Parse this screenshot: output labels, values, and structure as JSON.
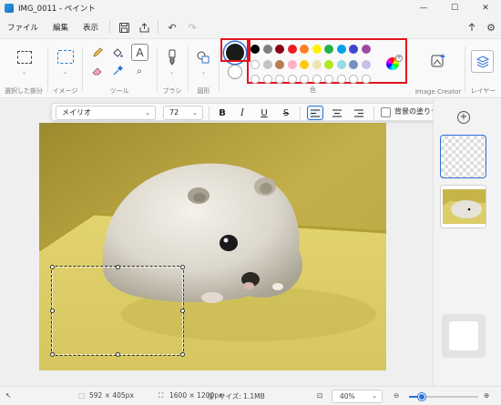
{
  "window": {
    "title": "IMG_0011 - ペイント",
    "controls": [
      "—",
      "☐",
      "✕"
    ]
  },
  "menu": {
    "items": [
      "ファイル",
      "編集",
      "表示"
    ],
    "save_icon": "save-icon",
    "share_icon": "share-icon",
    "undo_icon": "undo-icon",
    "redo_icon": "redo-icon"
  },
  "ribbon": {
    "groups": {
      "selection": "選択した部分",
      "image": "イメージ",
      "tools": "ツール",
      "brushes": "ブラシ",
      "shapes": "図形",
      "colors": "色",
      "image_creator": "Image Creator",
      "layers": "レイヤー"
    }
  },
  "colors": {
    "current": "#1a1a1a",
    "secondary": "#ffffff",
    "highlight": "#e3121c",
    "row1": [
      "#000000",
      "#7f7f7f",
      "#880015",
      "#ed1c24",
      "#ff7f27",
      "#fff200",
      "#22b14c",
      "#00a2e8",
      "#3f48cc",
      "#a349a4"
    ],
    "row2": [
      "#ffffff",
      "#c3c3c3",
      "#b97a57",
      "#ffaec9",
      "#ffc90e",
      "#efe4b0",
      "#b5e61d",
      "#99d9ea",
      "#7092be",
      "#c8bfe7"
    ]
  },
  "text_toolbar": {
    "font": "メイリオ",
    "size": "72",
    "bold": "B",
    "italic": "I",
    "underline": "U",
    "strike": "S",
    "fill_background": "背景の塗りつぶし"
  },
  "status": {
    "selection_size": "592 × 405px",
    "image_size": "1600 × 1200px",
    "file_size": "サイズ: 1.1MB",
    "zoom": "40%",
    "zoom_fraction": 0.18
  }
}
